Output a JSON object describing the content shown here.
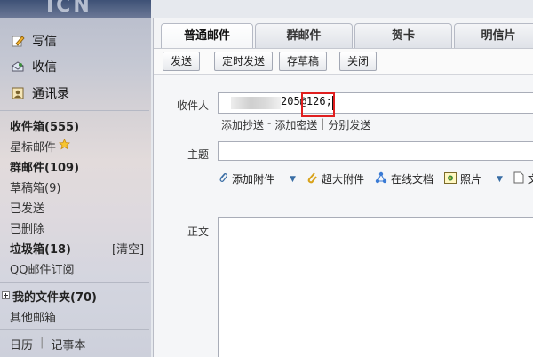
{
  "sidebar": {
    "logo_text": "ICN",
    "quick": [
      {
        "label": "写信",
        "icon": "pencil-icon"
      },
      {
        "label": "收信",
        "icon": "inbox-icon"
      },
      {
        "label": "通讯录",
        "icon": "contacts-icon"
      }
    ],
    "folders": {
      "inbox": "收件箱(555)",
      "starred": "星标邮件",
      "group": "群邮件(109)",
      "drafts": "草稿箱(9)",
      "sent": "已发送",
      "deleted": "已删除",
      "spam": "垃圾箱(18)",
      "spam_clear": "[清空]",
      "subscription": "QQ邮件订阅",
      "my_folders": "我的文件夹(70)",
      "other_mailbox": "其他邮箱"
    },
    "bottom": {
      "calendar": "日历",
      "notepad": "记事本"
    }
  },
  "tabs": [
    "普通邮件",
    "群邮件",
    "贺卡",
    "明信片"
  ],
  "active_tab": "普通邮件",
  "toolbar": {
    "send": "发送",
    "scheduled_send": "定时发送",
    "save_draft": "存草稿",
    "close": "关闭"
  },
  "compose": {
    "to_label": "收件人",
    "to_value_visible": "205@126;",
    "add_cc": "添加抄送",
    "dash": "-",
    "add_bcc": "添加密送",
    "pipe": "|",
    "separate_send": "分别发送",
    "subject_label": "主题",
    "subject_value": "",
    "attach": {
      "add": "添加附件",
      "large": "超大附件",
      "online_doc": "在线文档",
      "photo": "照片",
      "more": "文"
    },
    "body_label": "正文",
    "body_value": ""
  },
  "colors": {
    "highlight": "#e01f1f",
    "link": "#3a6ea5"
  }
}
